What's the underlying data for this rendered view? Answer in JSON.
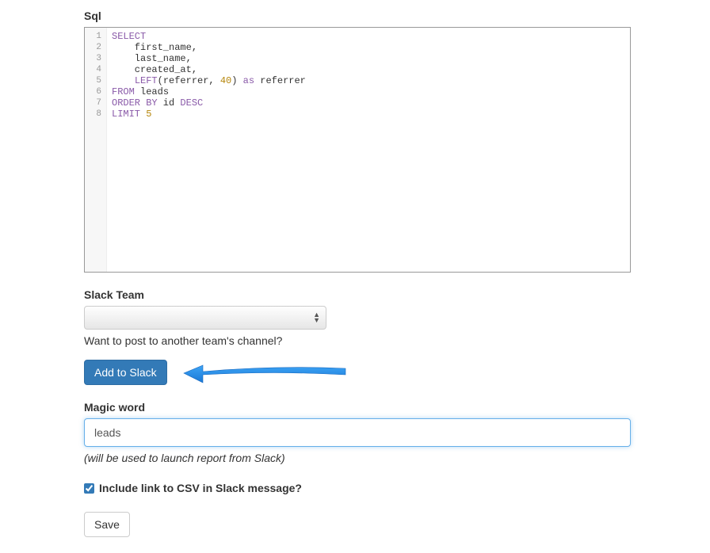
{
  "labels": {
    "sql": "Sql",
    "slack_team": "Slack Team",
    "magic_word": "Magic word"
  },
  "sql": {
    "line_count": 8,
    "lines": [
      {
        "seg": [
          {
            "t": "SELECT",
            "c": "kw"
          }
        ]
      },
      {
        "seg": [
          {
            "t": "    first_name,",
            "c": ""
          }
        ]
      },
      {
        "seg": [
          {
            "t": "    last_name,",
            "c": ""
          }
        ]
      },
      {
        "seg": [
          {
            "t": "    created_at,",
            "c": ""
          }
        ]
      },
      {
        "seg": [
          {
            "t": "    ",
            "c": ""
          },
          {
            "t": "LEFT",
            "c": "kw"
          },
          {
            "t": "(referrer, ",
            "c": ""
          },
          {
            "t": "40",
            "c": "num"
          },
          {
            "t": ") ",
            "c": ""
          },
          {
            "t": "as",
            "c": "kw"
          },
          {
            "t": " referrer",
            "c": ""
          }
        ]
      },
      {
        "seg": [
          {
            "t": "FROM",
            "c": "kw"
          },
          {
            "t": " leads",
            "c": ""
          }
        ]
      },
      {
        "seg": [
          {
            "t": "ORDER BY",
            "c": "kw"
          },
          {
            "t": " id ",
            "c": ""
          },
          {
            "t": "DESC",
            "c": "kw"
          }
        ]
      },
      {
        "seg": [
          {
            "t": "LIMIT",
            "c": "kw"
          },
          {
            "t": " ",
            "c": ""
          },
          {
            "t": "5",
            "c": "num"
          }
        ]
      }
    ]
  },
  "slack": {
    "helper": "Want to post to another team's channel?",
    "add_button": "Add to Slack"
  },
  "magic_word": {
    "value": "leads",
    "hint": "(will be used to launch report from Slack)"
  },
  "checkbox": {
    "label": "Include link to CSV in Slack message?",
    "checked": true
  },
  "buttons": {
    "save": "Save"
  }
}
